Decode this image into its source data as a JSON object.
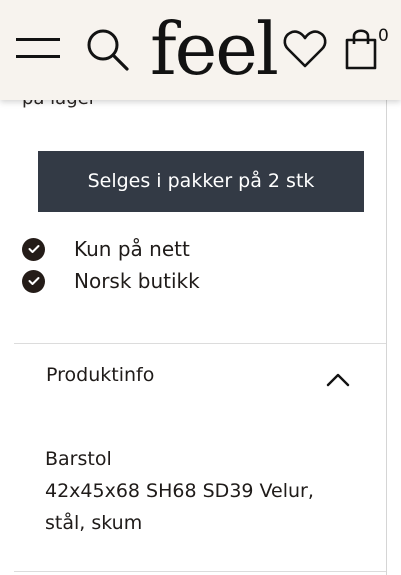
{
  "header": {
    "logo": "feel",
    "cart_count": "0",
    "icons": [
      "menu-icon",
      "search-icon",
      "heart-icon",
      "shopping-bag-icon"
    ]
  },
  "product": {
    "stock_text_partial": "på lager",
    "pack_button_label": "Selges i pakker på 2 stk",
    "features": [
      {
        "label": "Kun på nett",
        "icon": "check-circle-icon"
      },
      {
        "label": "Norsk butikk",
        "icon": "check-circle-icon"
      }
    ]
  },
  "accordion": {
    "title": "Produktinfo",
    "expanded": true,
    "description_lines": [
      "Barstol",
      "42x45x68 SH68 SD39 Velur,",
      "stål, skum"
    ]
  },
  "colors": {
    "header_bg": "#f7f3ee",
    "button_bg": "#333a45",
    "check_bg": "#241c18"
  }
}
